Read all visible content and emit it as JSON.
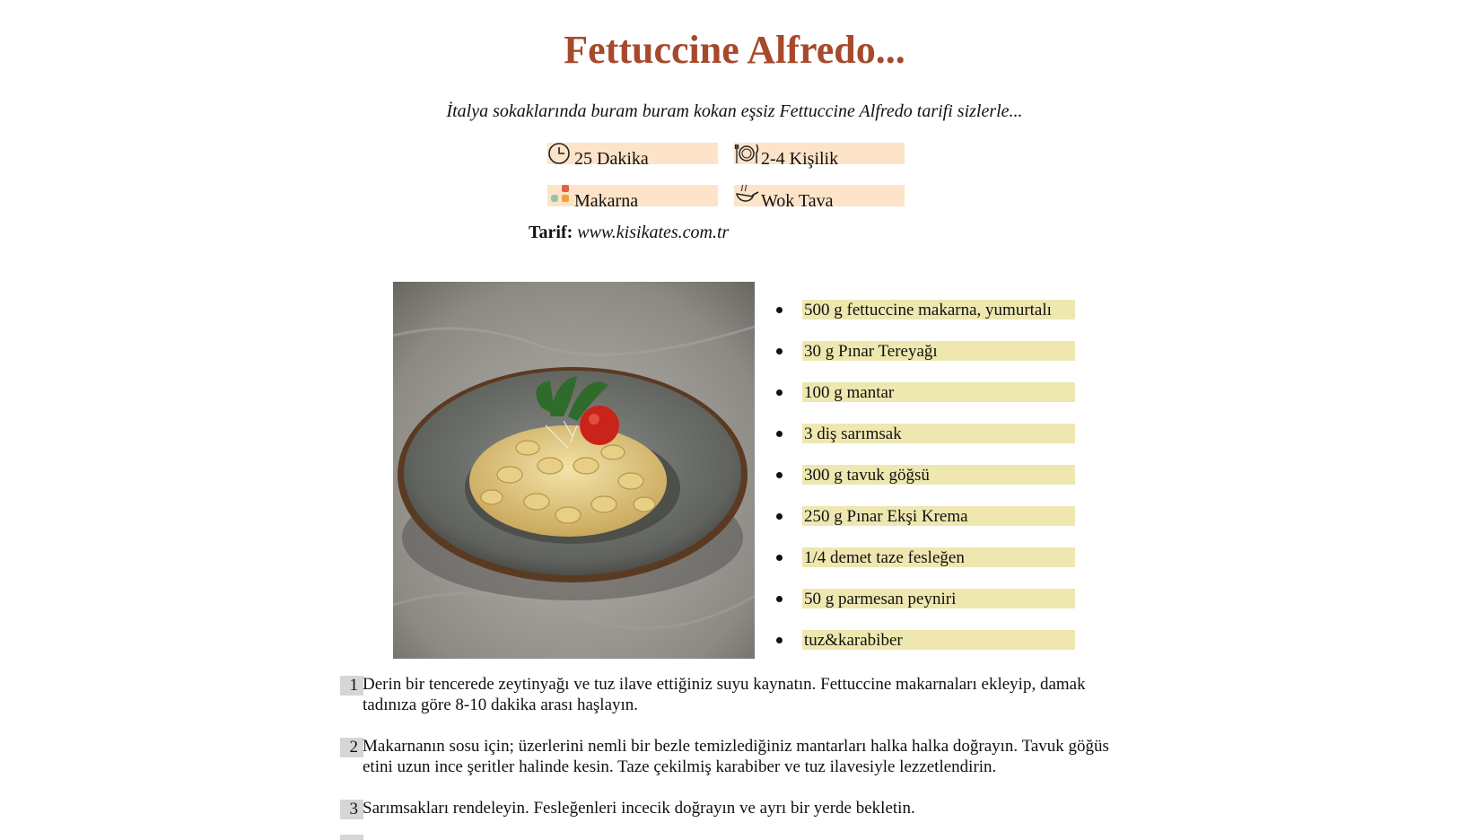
{
  "recipe": {
    "title": "Fettuccine Alfredo...",
    "subtitle": "İtalya sokaklarında buram buram kokan eşsiz Fettuccine Alfredo tarifi sizlerle...",
    "info": {
      "time": "25 Dakika",
      "servings": "2-4 Kişilik",
      "category": "Makarna",
      "equipment": "Wok Tava"
    },
    "source_label": "Tarif:",
    "source_value": "www.kisikates.com.tr"
  },
  "ingredients": [
    "500 g fettuccine makarna, yumurtalı",
    "30 g Pınar Tereyağı",
    "100 g mantar",
    "3 diş sarımsak",
    "300 g tavuk göğsü",
    "250 g Pınar Ekşi Krema",
    "1/4 demet taze fesleğen",
    "50 g parmesan peyniri",
    "tuz&karabiber"
  ],
  "steps": [
    {
      "num": "1",
      "text": "Derin bir tencerede zeytinyağı ve tuz ilave ettiğiniz suyu kaynatın. Fettuccine makarnaları ekleyip, damak tadınıza göre 8-10 dakika arası haşlayın."
    },
    {
      "num": "2",
      "text": "Makarnanın sosu için; üzerlerini nemli bir bezle temizlediğiniz mantarları halka halka doğrayın. Tavuk göğüs etini uzun ince şeritler halinde kesin. Taze çekilmiş karabiber ve tuz ilavesiyle lezzetlendirin."
    },
    {
      "num": "3",
      "text": "Sarımsakları rendeleyin. Fesleğenleri incecik doğrayın ve ayrı bir yerde bekletin."
    }
  ],
  "colors": {
    "title": "#a64a2b",
    "info_bg": "#fde4c8",
    "ingredient_bg": "#efe7b0",
    "step_num_bg": "#d6d6d6"
  },
  "icons": {
    "time": "clock-icon",
    "servings": "plate-cutlery-icon",
    "category": "category-dots-icon",
    "equipment": "wok-pan-icon"
  }
}
